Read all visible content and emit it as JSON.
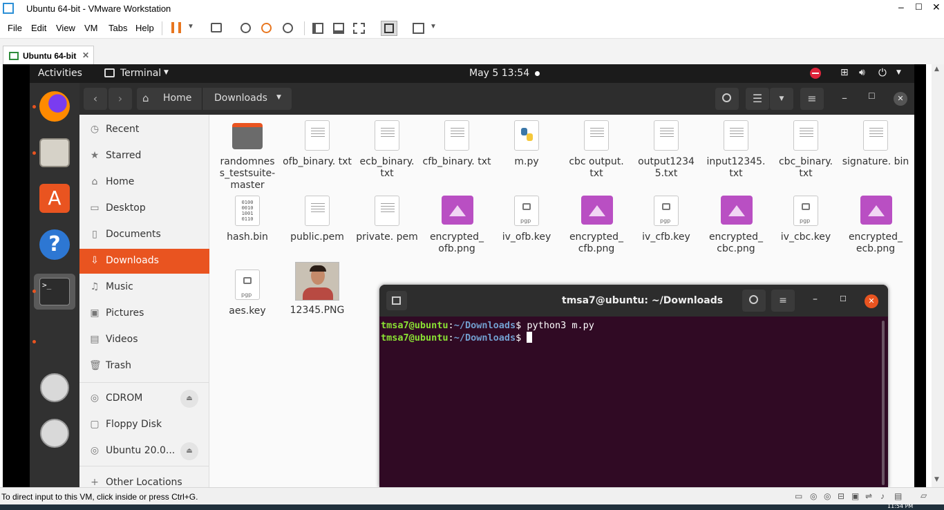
{
  "vmware": {
    "title": "Ubuntu 64-bit - VMware Workstation",
    "menu": [
      "File",
      "Edit",
      "View",
      "VM",
      "Tabs",
      "Help"
    ],
    "tab_label": "Ubuntu 64-bit",
    "status_text": "To direct input to this VM, click inside or press Ctrl+G.",
    "taskbar_time": "11:54 PM"
  },
  "ubuntu_topbar": {
    "activities": "Activities",
    "app_menu": "Terminal",
    "clock": "May 5  13:54"
  },
  "files": {
    "path": {
      "home": "Home",
      "current": "Downloads"
    },
    "sidebar": {
      "places": [
        {
          "label": "Recent",
          "icon": "clock-icon"
        },
        {
          "label": "Starred",
          "icon": "star-icon"
        },
        {
          "label": "Home",
          "icon": "home-icon"
        },
        {
          "label": "Desktop",
          "icon": "desktop-icon"
        },
        {
          "label": "Documents",
          "icon": "document-icon"
        },
        {
          "label": "Downloads",
          "icon": "download-icon",
          "active": true
        },
        {
          "label": "Music",
          "icon": "music-icon"
        },
        {
          "label": "Pictures",
          "icon": "picture-icon"
        },
        {
          "label": "Videos",
          "icon": "video-icon"
        },
        {
          "label": "Trash",
          "icon": "trash-icon"
        }
      ],
      "devices": [
        {
          "label": "CDROM",
          "eject": true
        },
        {
          "label": "Floppy Disk",
          "eject": false
        },
        {
          "label": "Ubuntu 20.0...",
          "eject": true
        }
      ],
      "other": "Other Locations"
    },
    "items": [
      {
        "name": "randomnes s_testsuite- master",
        "type": "folder"
      },
      {
        "name": "ofb_binary. txt",
        "type": "text"
      },
      {
        "name": "ecb_binary. txt",
        "type": "text"
      },
      {
        "name": "cfb_binary. txt",
        "type": "text"
      },
      {
        "name": "m.py",
        "type": "python"
      },
      {
        "name": "cbc output. txt",
        "type": "text"
      },
      {
        "name": "output1234 5.txt",
        "type": "text"
      },
      {
        "name": "input12345. txt",
        "type": "text"
      },
      {
        "name": "cbc_binary. txt",
        "type": "text"
      },
      {
        "name": "signature. bin",
        "type": "text"
      },
      {
        "name": "hash.bin",
        "type": "binary"
      },
      {
        "name": "public.pem",
        "type": "text"
      },
      {
        "name": "private. pem",
        "type": "text"
      },
      {
        "name": "encrypted_ ofb.png",
        "type": "image"
      },
      {
        "name": "iv_ofb.key",
        "type": "key"
      },
      {
        "name": "encrypted_ cfb.png",
        "type": "image"
      },
      {
        "name": "iv_cfb.key",
        "type": "key"
      },
      {
        "name": "encrypted_ cbc.png",
        "type": "image"
      },
      {
        "name": "iv_cbc.key",
        "type": "key"
      },
      {
        "name": "encrypted_ ecb.png",
        "type": "image"
      },
      {
        "name": "aes.key",
        "type": "key"
      },
      {
        "name": "12345.PNG",
        "type": "photo"
      }
    ],
    "binary_icon_text": "0100\n0010\n1001\n0110",
    "key_icon_text": "pgp"
  },
  "terminal": {
    "title": "tmsa7@ubuntu: ~/Downloads",
    "lines": [
      {
        "user": "tmsa7@ubuntu",
        "sep": ":",
        "path": "~/Downloads",
        "dollar": "$",
        "cmd": " python3 m.py"
      },
      {
        "user": "tmsa7@ubuntu",
        "sep": ":",
        "path": "~/Downloads",
        "dollar": "$",
        "cmd": " "
      }
    ]
  },
  "colors": {
    "ubuntu_orange": "#e95420",
    "terminal_bg": "#300a24",
    "prompt_user": "#8ae234",
    "prompt_path": "#729fcf",
    "image_purple": "#b94fc3"
  }
}
